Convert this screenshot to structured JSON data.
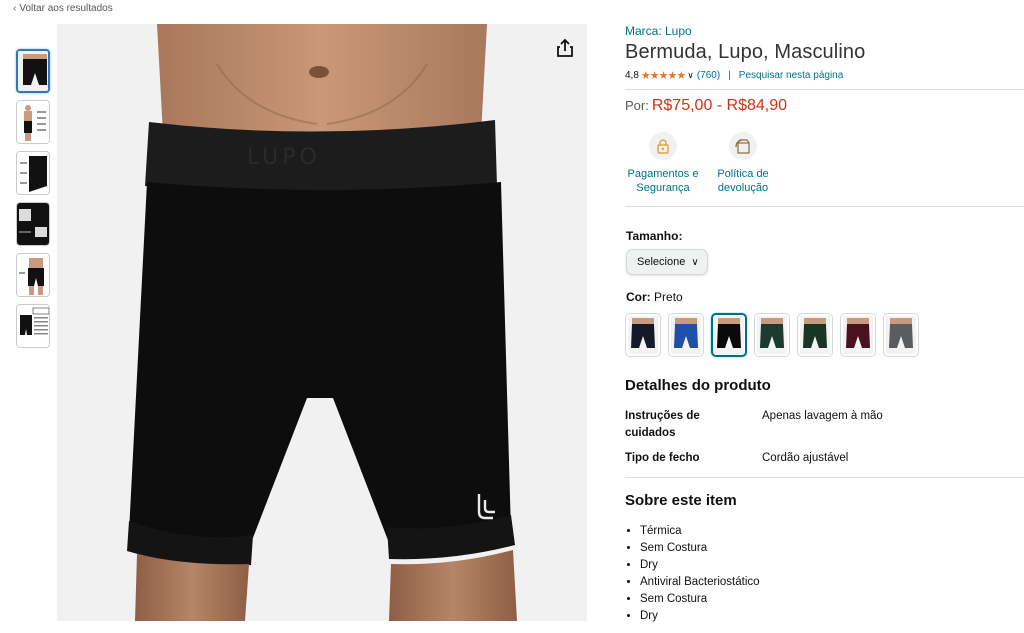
{
  "nav": {
    "back_label": "Voltar aos resultados"
  },
  "product": {
    "brand": "Marca: Lupo",
    "title": "Bermuda, Lupo, Masculino",
    "rating": "4,8",
    "rating_stars": "★★★★★",
    "reviews": "(760)",
    "search_page": "Pesquisar nesta página",
    "price_prefix": "Por:",
    "price": "R$75,00 - R$84,90"
  },
  "features": [
    {
      "icon": "lock-icon",
      "label_line1": "Pagamentos e",
      "label_line2": "Segurança"
    },
    {
      "icon": "return-box-icon",
      "label_line1": "Política de",
      "label_line2": "devolução"
    }
  ],
  "size": {
    "label": "Tamanho:",
    "selected": "Selecione"
  },
  "color": {
    "label": "Cor:",
    "selected": "Preto",
    "swatches": [
      "#141a2a",
      "#1f4fa8",
      "#0a0a0a",
      "#1d3a2f",
      "#183528",
      "#4a1220",
      "#5a5c60"
    ]
  },
  "details": {
    "heading": "Detalhes do produto",
    "rows": [
      {
        "key": "Instruções de cuidados",
        "value": "Apenas lavagem à mão"
      },
      {
        "key": "Tipo de fecho",
        "value": "Cordão ajustável"
      }
    ]
  },
  "about": {
    "heading": "Sobre este item",
    "items": [
      "Térmica",
      "Sem Costura",
      "Dry",
      "Antiviral Bacteriostático",
      "Sem Costura",
      "Dry"
    ]
  },
  "colors": {
    "link": "#007185",
    "price": "#cc3316",
    "star": "#de7921",
    "active_thumb": "#2d78c2"
  }
}
